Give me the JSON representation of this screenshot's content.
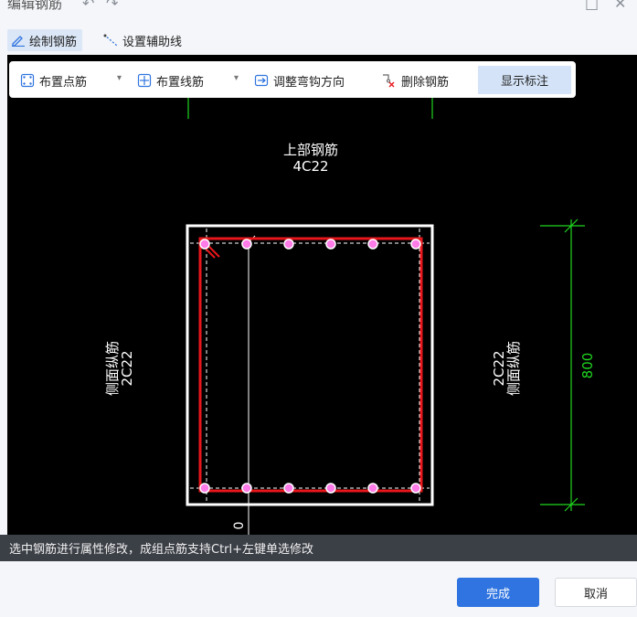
{
  "window": {
    "title": "编辑钢筋",
    "undo_icon": "undo-icon",
    "redo_icon": "redo-icon",
    "maximize_icon": "maximize-icon",
    "close_icon": "close-icon"
  },
  "mode_tabs": [
    {
      "label": "绘制钢筋",
      "icon": "pencil-icon",
      "active": true
    },
    {
      "label": "设置辅助线",
      "icon": "auxiliary-line-icon",
      "active": false
    }
  ],
  "toolbar": {
    "place_point_rebar": "布置点筋",
    "place_line_rebar": "布置线筋",
    "adjust_hook": "调整弯钩方向",
    "delete_rebar": "删除钢筋",
    "show_annotation": "显示标注"
  },
  "drawing": {
    "top_label_line1": "上部钢筋",
    "top_label_line2": "4C22",
    "left_label_line1": "侧面纵筋",
    "left_label_line2": "2C22",
    "right_label_line1": "侧面纵筋",
    "right_label_line2": "2C22",
    "dimension_value": "800",
    "bottom_marker": "0",
    "colors": {
      "section_border": "#ffffff",
      "stirrup": "#e8161b",
      "rebar_point": "#ff7be8",
      "dimension": "#1fd61f"
    }
  },
  "status_text": "选中钢筋进行属性修改，成组点筋支持Ctrl+左键单选修改",
  "buttons": {
    "confirm": "完成",
    "cancel": "取消"
  }
}
